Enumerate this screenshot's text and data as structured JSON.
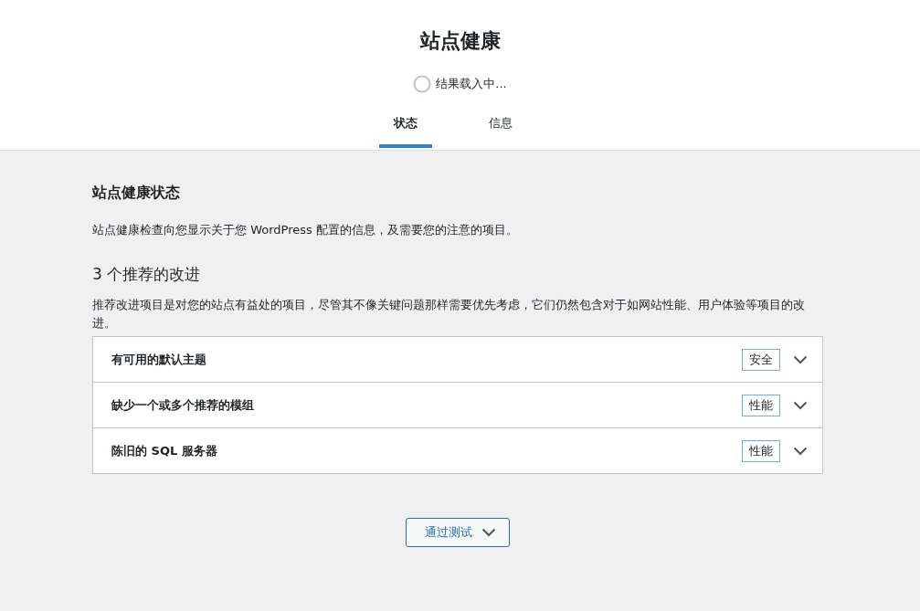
{
  "header": {
    "title": "站点健康",
    "progress": {
      "label": "结果载入中..."
    }
  },
  "tabs": [
    {
      "label": "状态",
      "selected": true
    },
    {
      "label": "信息",
      "selected": false
    }
  ],
  "status": {
    "heading": "站点健康状态",
    "description": "站点健康检查向您显示关于您 WordPress 配置的信息，及需要您的注意的项目。"
  },
  "recommended": {
    "heading": "3 个推荐的改进",
    "description": "推荐改进项目是对您的站点有益处的项目，尽管其不像关键问题那样需要优先考虑，它们仍然包含对于如网站性能、用户体验等项目的改进。",
    "items": [
      {
        "title": "有可用的默认主题",
        "badge": "安全",
        "expanded": false
      },
      {
        "title": "缺少一个或多个推荐的模组",
        "badge": "性能",
        "expanded": false
      },
      {
        "title": "陈旧的 SQL 服务器",
        "badge": "性能",
        "expanded": false
      }
    ]
  },
  "passed_button": {
    "label": "通过测试",
    "expanded": false
  }
}
